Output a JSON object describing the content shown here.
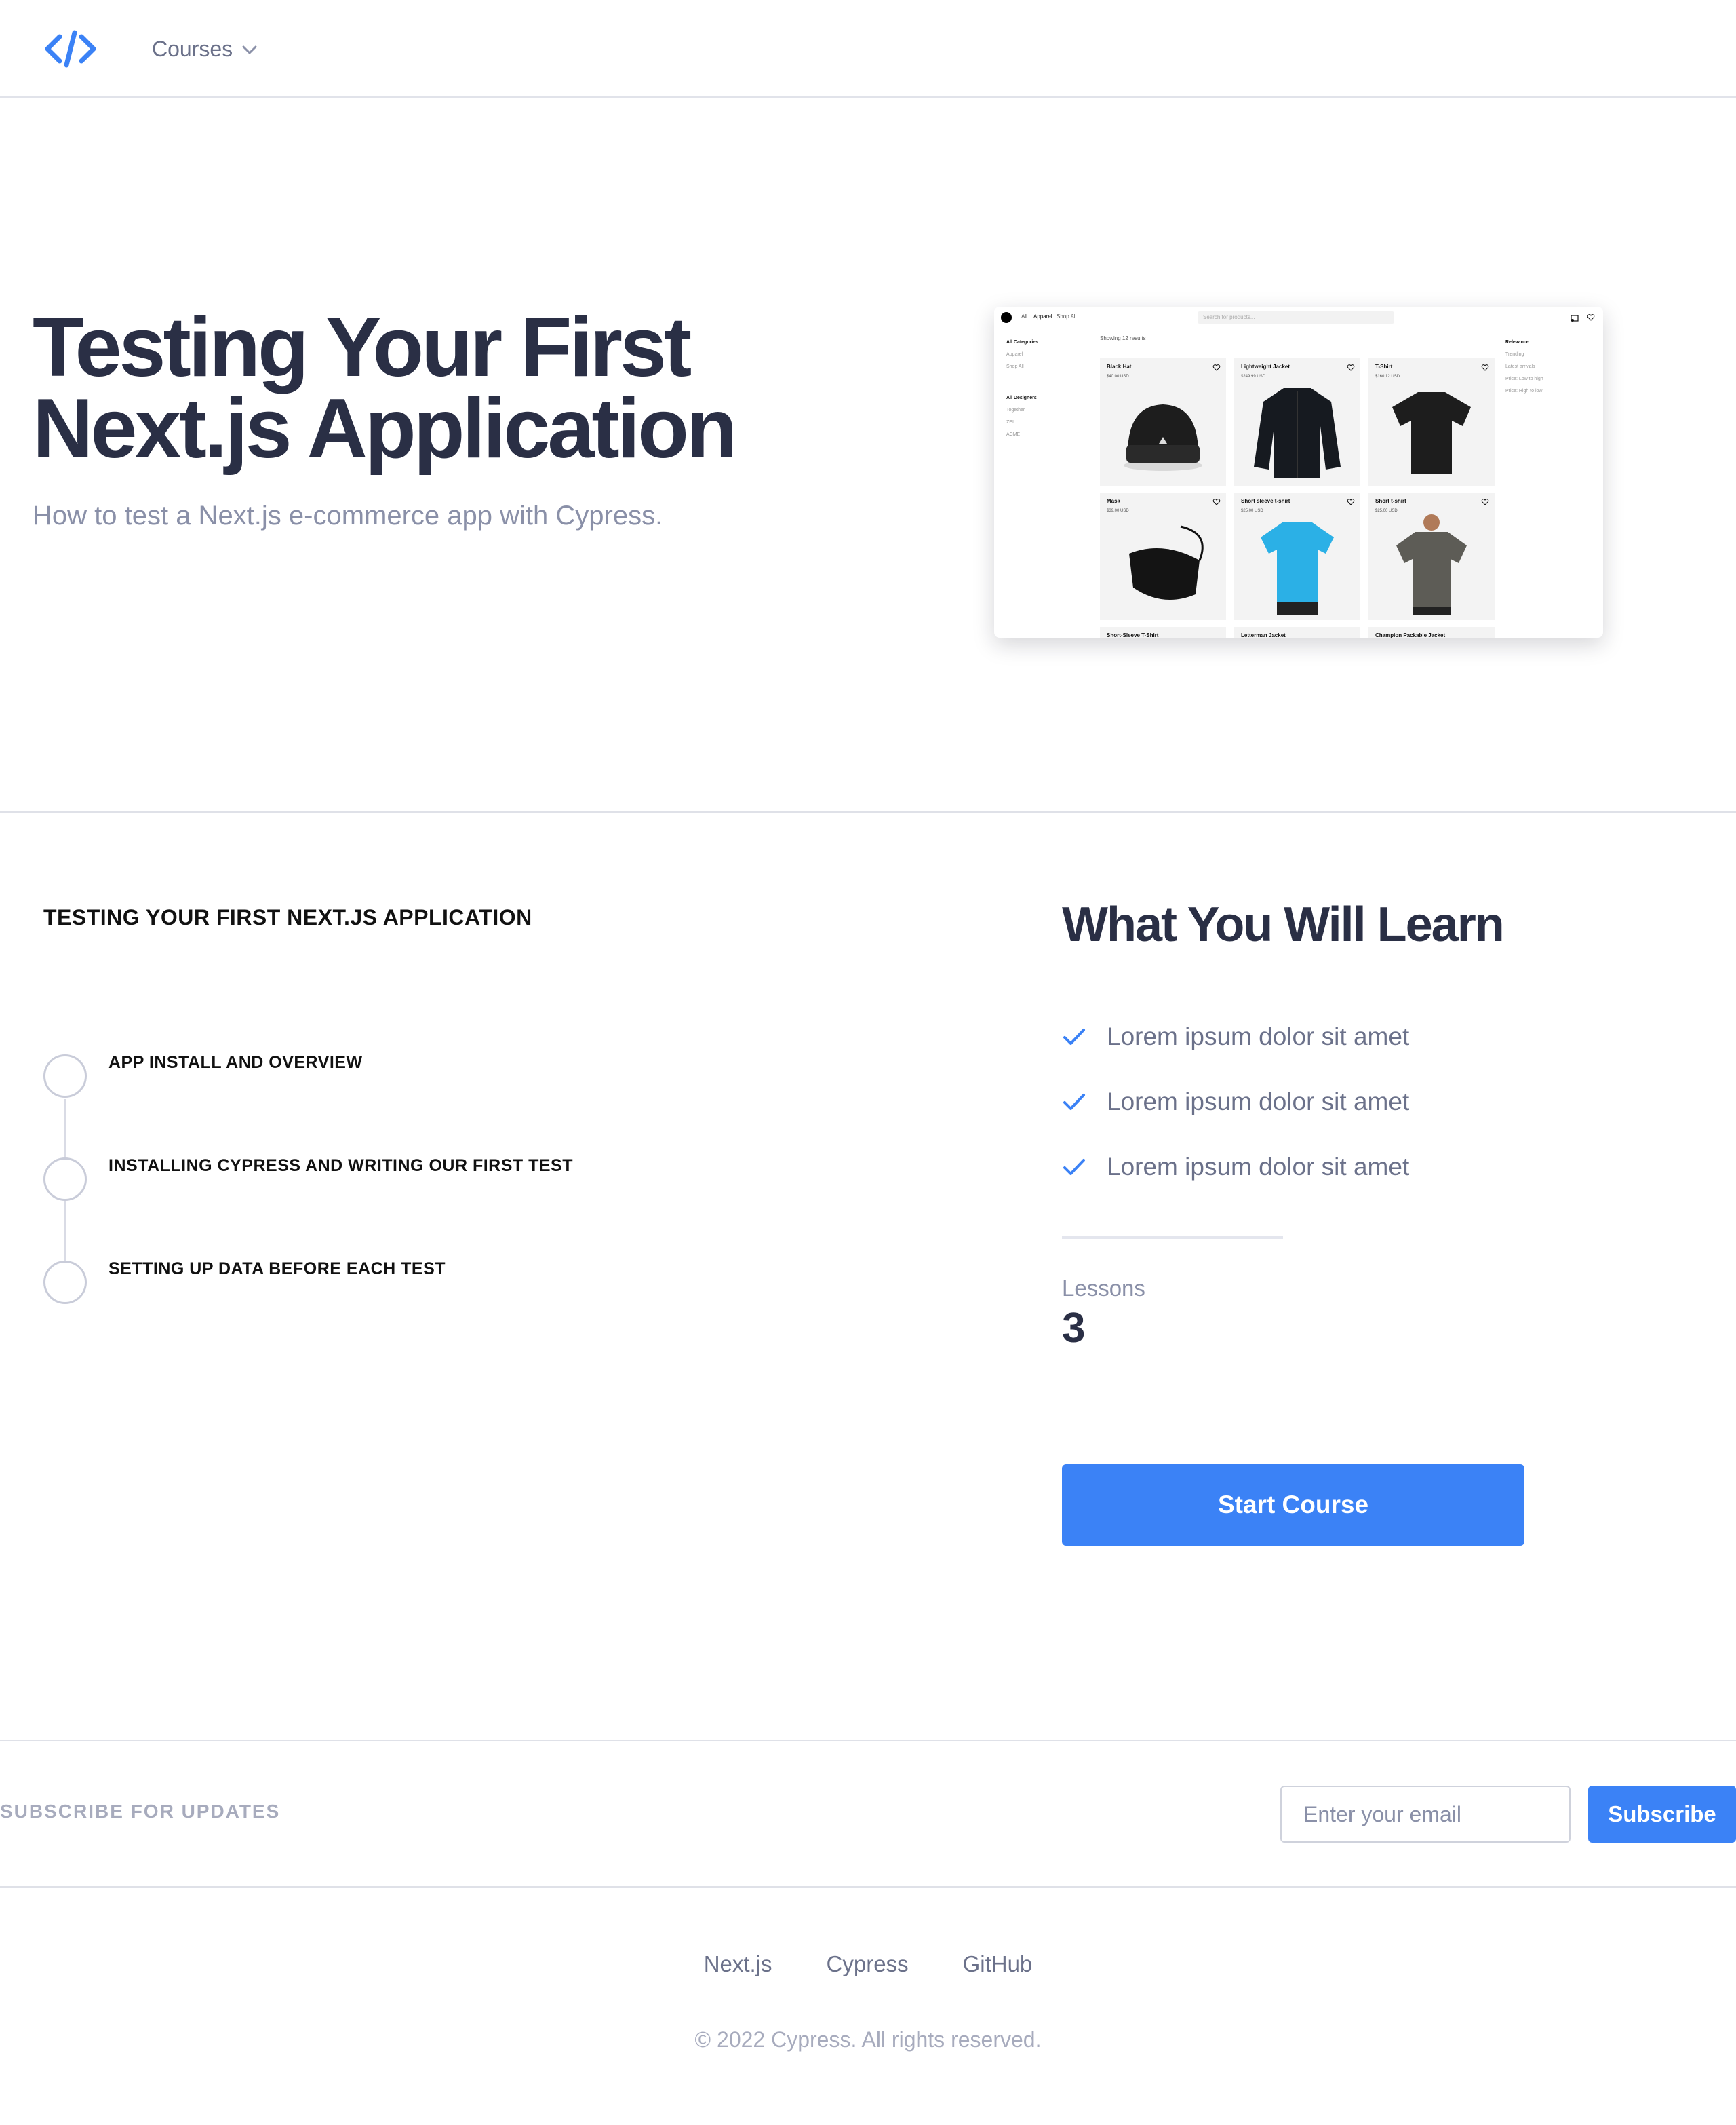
{
  "header": {
    "logo_icon": "code-brackets-icon",
    "nav_courses": "Courses",
    "chevron_icon": "chevron-down-icon"
  },
  "hero": {
    "title_line1": "Testing Your First",
    "title_line2": "Next.js Application",
    "subtitle": "How to test a Next.js e-commerce app with Cypress.",
    "preview": {
      "nav": [
        "All",
        "Apparel",
        "Shop All"
      ],
      "search_placeholder": "Search for products...",
      "showing": "Showing 12 results",
      "categories_title": "All Categories",
      "categories": [
        "Apparel",
        "Shop All"
      ],
      "designers_title": "All Designers",
      "designers": [
        "Together",
        "ZEI",
        "ACME"
      ],
      "sort_title": "Relevance",
      "sort_options": [
        "Trending",
        "Latest arrivals",
        "Price: Low to high",
        "Price: High to low"
      ],
      "products": [
        {
          "name": "Black Hat",
          "price": "$40.00 USD"
        },
        {
          "name": "Lightweight Jacket",
          "price": "$249.99 USD"
        },
        {
          "name": "T-Shirt",
          "price": "$160.12 USD"
        },
        {
          "name": "Mask",
          "price": "$39.00 USD"
        },
        {
          "name": "Short sleeve t-shirt",
          "price": "$25.00 USD"
        },
        {
          "name": "Short t-shirt",
          "price": "$25.00 USD"
        },
        {
          "name": "Short-Sleeve T-Shirt",
          "price": ""
        },
        {
          "name": "Letterman Jacket",
          "price": ""
        },
        {
          "name": "Champion Packable Jacket",
          "price": ""
        }
      ]
    }
  },
  "curriculum": {
    "title": "TESTING YOUR FIRST NEXT.JS APPLICATION",
    "lessons": [
      "APP INSTALL AND OVERVIEW",
      "INSTALLING CYPRESS AND WRITING OUR FIRST TEST",
      "SETTING UP DATA BEFORE EACH TEST"
    ]
  },
  "learn": {
    "title": "What You Will Learn",
    "check_icon": "check-icon",
    "items": [
      "Lorem ipsum dolor sit amet",
      "Lorem ipsum dolor sit amet",
      "Lorem ipsum dolor sit amet"
    ],
    "lessons_label": "Lessons",
    "lessons_count": "3",
    "start_button": "Start Course"
  },
  "subscribe": {
    "label": "SUBSCRIBE FOR UPDATES",
    "email_placeholder": "Enter your email",
    "button": "Subscribe"
  },
  "footer": {
    "links": [
      "Next.js",
      "Cypress",
      "GitHub"
    ],
    "copyright": "© 2022 Cypress. All rights reserved."
  },
  "colors": {
    "accent": "#3b82f6",
    "heading": "#2a2f45",
    "muted": "#6b718a",
    "divider": "#dfe1e8"
  }
}
